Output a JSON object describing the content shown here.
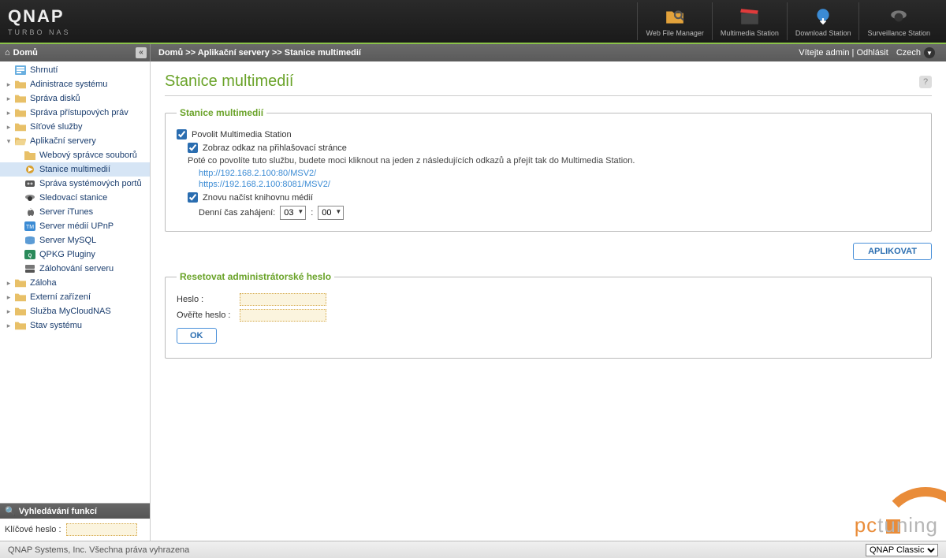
{
  "header": {
    "logo": "QNAP",
    "sublogo": "TURBO NAS",
    "apps": [
      {
        "name": "web-file-manager",
        "label": "Web File Manager"
      },
      {
        "name": "multimedia-station",
        "label": "Multimedia Station"
      },
      {
        "name": "download-station",
        "label": "Download Station"
      },
      {
        "name": "surveillance-station",
        "label": "Surveillance Station"
      }
    ]
  },
  "topbar": {
    "home": "Domů",
    "breadcrumb": "Domů >> Aplikační servery >> Stanice multimedií",
    "welcome": "Vítejte admin",
    "logout": "Odhlásit",
    "language": "Czech"
  },
  "sidebar": {
    "items": [
      {
        "label": "Shrnutí",
        "type": "leaf",
        "icon": "summary"
      },
      {
        "label": "Adinistrace systému",
        "type": "closed",
        "icon": "folder"
      },
      {
        "label": "Správa disků",
        "type": "closed",
        "icon": "folder"
      },
      {
        "label": "Správa přístupových práv",
        "type": "closed",
        "icon": "folder"
      },
      {
        "label": "Síťové služby",
        "type": "closed",
        "icon": "folder"
      },
      {
        "label": "Aplikační servery",
        "type": "open",
        "icon": "folder-open",
        "children": [
          {
            "label": "Webový správce souborů",
            "icon": "web"
          },
          {
            "label": "Stanice multimedií",
            "icon": "media",
            "selected": true
          },
          {
            "label": "Správa systémových portů",
            "icon": "ports"
          },
          {
            "label": "Sledovací stanice",
            "icon": "cam"
          },
          {
            "label": "Server iTunes",
            "icon": "itunes"
          },
          {
            "label": "Server médií UPnP",
            "icon": "upnp"
          },
          {
            "label": "Server MySQL",
            "icon": "mysql"
          },
          {
            "label": "QPKG Pluginy",
            "icon": "qpkg"
          },
          {
            "label": "Zálohování serveru",
            "icon": "backup"
          }
        ]
      },
      {
        "label": "Záloha",
        "type": "closed",
        "icon": "folder"
      },
      {
        "label": "Externí zařízení",
        "type": "closed",
        "icon": "folder"
      },
      {
        "label": "Služba MyCloudNAS",
        "type": "closed",
        "icon": "folder"
      },
      {
        "label": "Stav systému",
        "type": "closed",
        "icon": "folder"
      }
    ],
    "searchTitle": "Vyhledávání funkcí",
    "searchLabel": "Klíčové heslo :"
  },
  "page": {
    "title": "Stanice multimedií",
    "fs1": {
      "legend": "Stanice multimedií",
      "enable": "Povolit Multimedia Station",
      "showLink": "Zobraz odkaz na přihlašovací stránce",
      "afterText": "Poté co povolíte tuto službu, budete moci kliknout na jeden z následujících odkazů a přejít tak do Multimedia Station.",
      "link1": "http://192.168.2.100:80/MSV2/",
      "link2": "https://192.168.2.100:8081/MSV2/",
      "rescan": "Znovu načíst knihovnu médií",
      "timeLabel": "Denní čas zahájení:",
      "hour": "03",
      "minute": "00"
    },
    "apply": "APLIKOVAT",
    "fs2": {
      "legend": "Resetovat administrátorské heslo",
      "pw": "Heslo :",
      "confirm": "Ověřte heslo :",
      "ok": "OK"
    }
  },
  "footer": {
    "copyright": "QNAP Systems, Inc. Všechna práva vyhrazena",
    "theme": "QNAP Classic"
  },
  "watermark": {
    "brand1": "pc",
    "brand2": "tuning"
  }
}
